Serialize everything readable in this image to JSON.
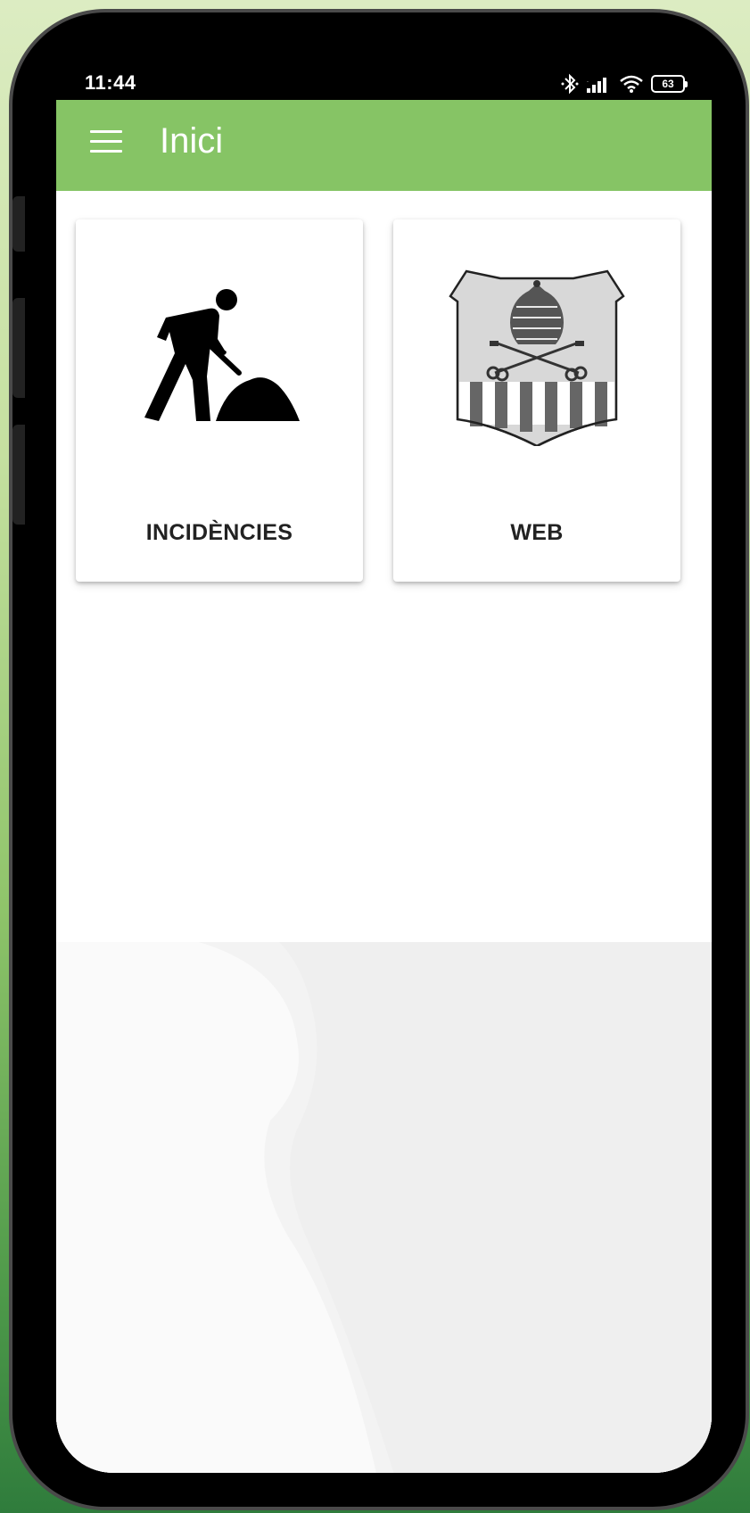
{
  "status_bar": {
    "time": "11:44",
    "battery_level": "63",
    "icons": [
      "bluetooth-icon",
      "signal-icon",
      "wifi-icon",
      "battery-icon"
    ]
  },
  "app_bar": {
    "title": "Inici",
    "menu_icon": "hamburger-menu-icon",
    "color": "#86c465"
  },
  "cards": [
    {
      "label": "INCIDÈNCIES",
      "icon": "worker-digging-icon"
    },
    {
      "label": "WEB",
      "icon": "coat-of-arms-icon"
    }
  ],
  "colors": {
    "accent": "#86c465",
    "card_text": "#222222"
  }
}
